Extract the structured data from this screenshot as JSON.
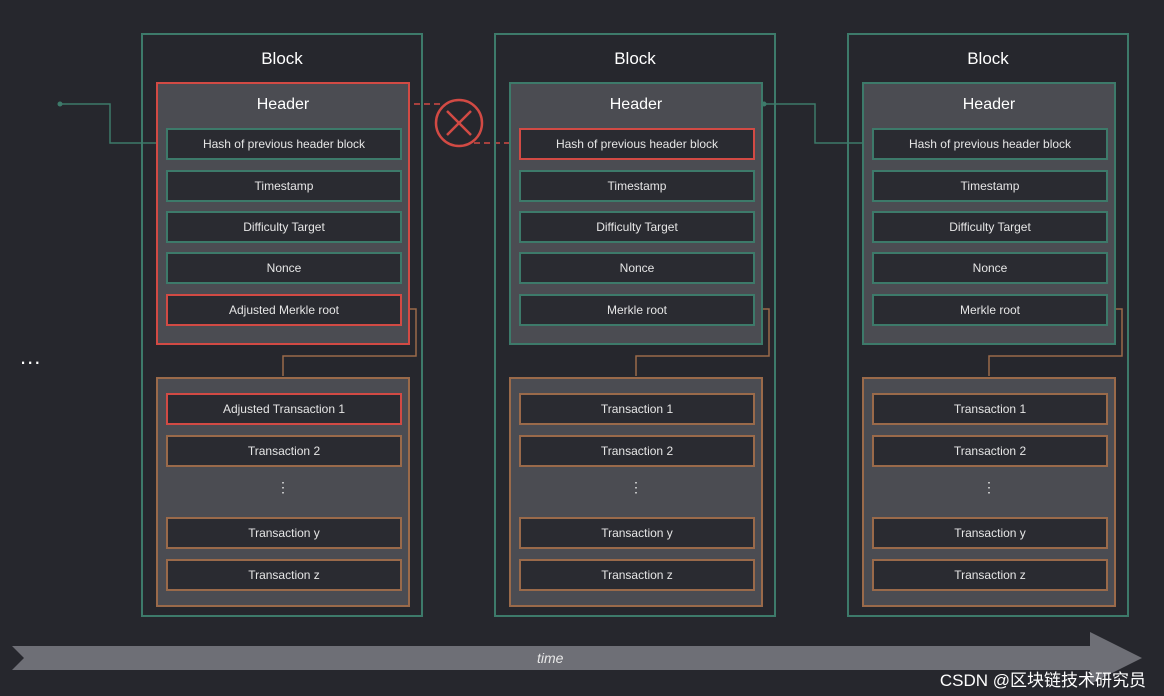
{
  "left_ellipsis": "...",
  "time_label": "time",
  "watermark": "CSDN @区块链技术研究员",
  "blocks": [
    {
      "title": "Block",
      "header_title": "Header",
      "fields": [
        "Hash of previous header block",
        "Timestamp",
        "Difficulty Target",
        "Nonce",
        "Adjusted Merkle root"
      ],
      "transactions": [
        "Adjusted Transaction 1",
        "Transaction 2",
        "Transaction y",
        "Transaction z"
      ],
      "ellipsis": "⋮"
    },
    {
      "title": "Block",
      "header_title": "Header",
      "fields": [
        "Hash of previous header block",
        "Timestamp",
        "Difficulty Target",
        "Nonce",
        "Merkle root"
      ],
      "transactions": [
        "Transaction 1",
        "Transaction 2",
        "Transaction y",
        "Transaction z"
      ],
      "ellipsis": "⋮"
    },
    {
      "title": "Block",
      "header_title": "Header",
      "fields": [
        "Hash of previous header block",
        "Timestamp",
        "Difficulty Target",
        "Nonce",
        "Merkle root"
      ],
      "transactions": [
        "Transaction 1",
        "Transaction 2",
        "Transaction y",
        "Transaction z"
      ],
      "ellipsis": "⋮"
    }
  ],
  "colors": {
    "background": "#26272d",
    "valid_link": "#3d7a6a",
    "tampered": "#d24a44",
    "transaction_border": "#9a6a4a",
    "panel_fill": "#4b4c52"
  }
}
